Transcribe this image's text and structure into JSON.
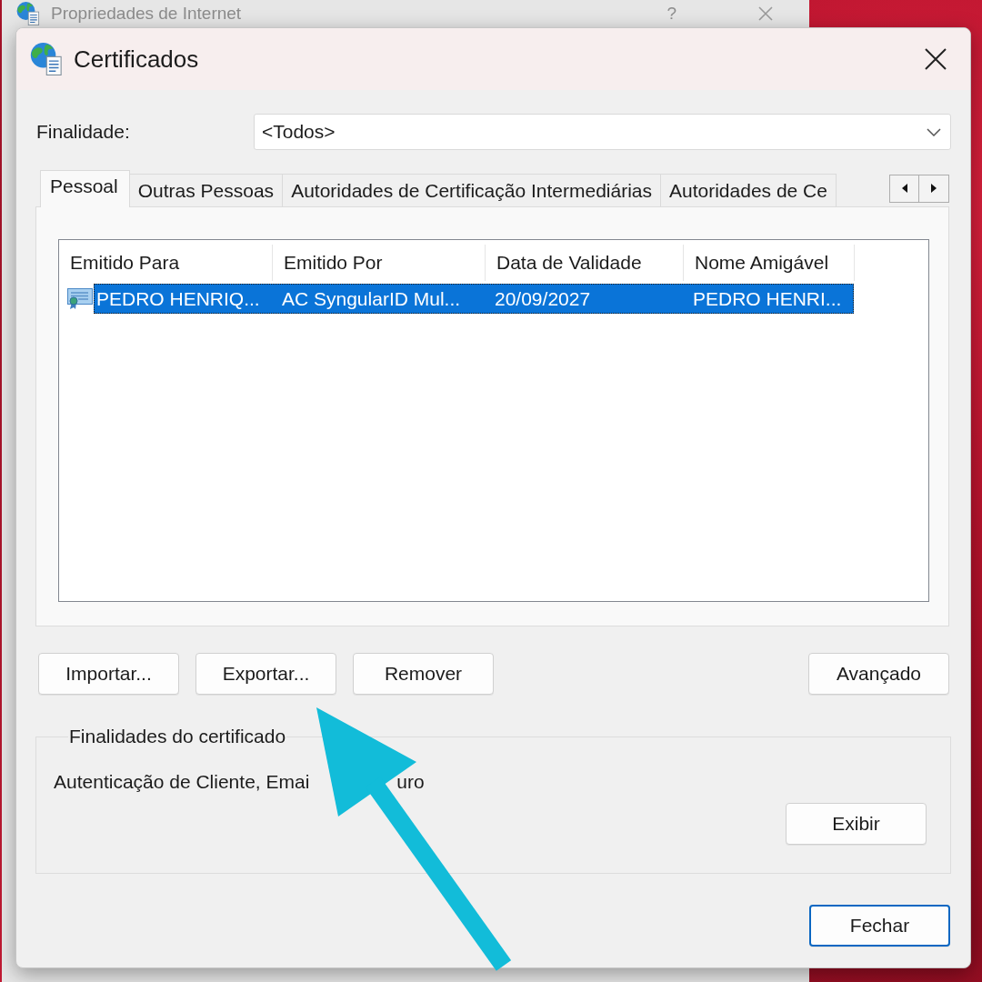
{
  "background_window": {
    "title": "Propriedades de Internet",
    "help_button": "?"
  },
  "dialog": {
    "title": "Certificados"
  },
  "purpose": {
    "label": "Finalidade:",
    "value": "<Todos>"
  },
  "tabs": [
    {
      "label": "Pessoal",
      "selected": true
    },
    {
      "label": "Outras Pessoas",
      "selected": false
    },
    {
      "label": "Autoridades de Certificação Intermediárias",
      "selected": false
    },
    {
      "label": "Autoridades de Ce",
      "selected": false
    }
  ],
  "certificate_list": {
    "columns": [
      "Emitido Para",
      "Emitido Por",
      "Data de Validade",
      "Nome Amigável"
    ],
    "rows": [
      {
        "cells": [
          "PEDRO HENRIQ...",
          "AC SyngularID Mul...",
          "20/09/2027",
          "PEDRO HENRI..."
        ],
        "selected": true
      }
    ]
  },
  "actions": [
    {
      "label": "Importar..."
    },
    {
      "label": "Exportar..."
    },
    {
      "label": "Remover"
    }
  ],
  "advanced_button": {
    "label": "Avançado"
  },
  "purposes_group": {
    "title": "Finalidades do certificado",
    "text_parts": [
      "Autenticação de Cliente, Emai",
      "uro"
    ],
    "view_button": {
      "label": "Exibir"
    }
  },
  "close_button": {
    "label": "Fechar",
    "default": true
  }
}
